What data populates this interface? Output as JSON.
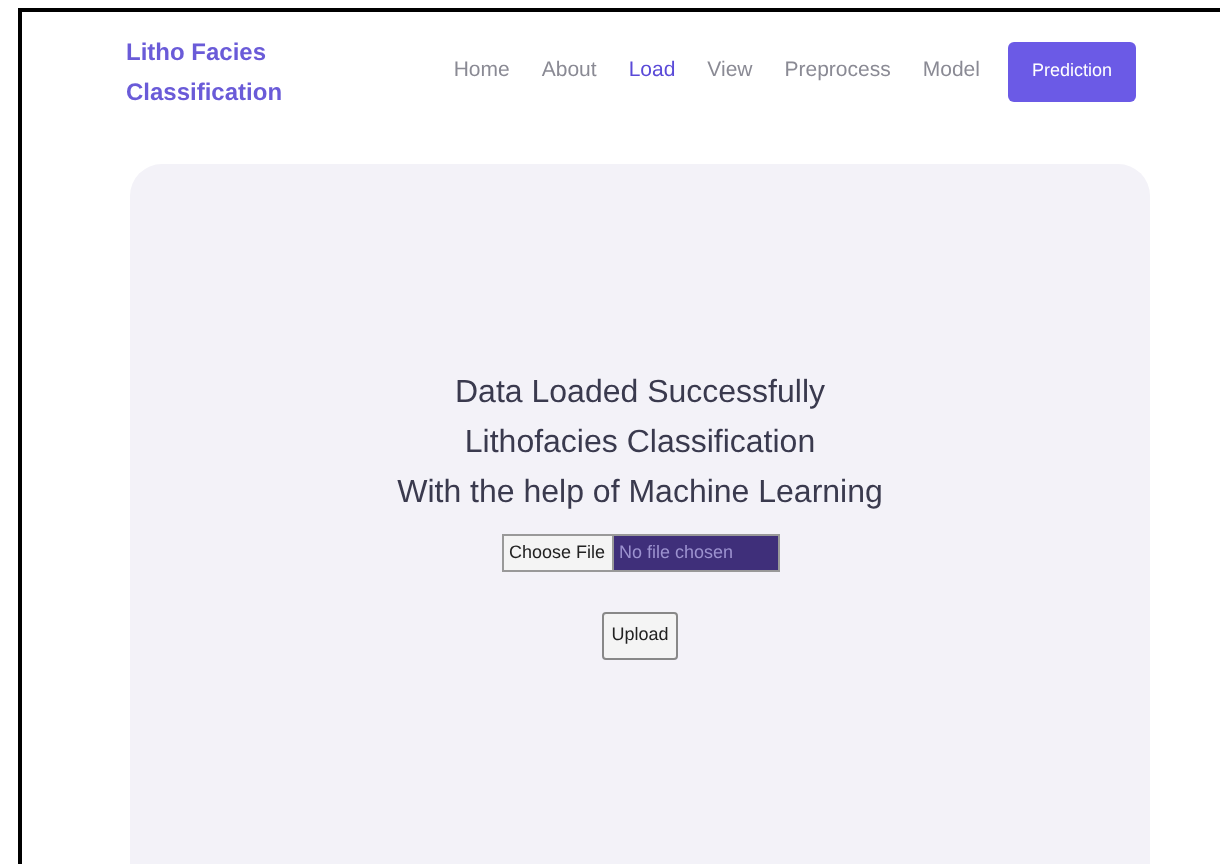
{
  "brand": {
    "line1": "Litho Facies",
    "line2": "Classification"
  },
  "nav": [
    {
      "label": "Home",
      "selected": false,
      "kind": "link"
    },
    {
      "label": "About",
      "selected": false,
      "kind": "link"
    },
    {
      "label": "Load",
      "selected": true,
      "kind": "link"
    },
    {
      "label": "View",
      "selected": false,
      "kind": "link"
    },
    {
      "label": "Preprocess",
      "selected": false,
      "kind": "link"
    },
    {
      "label": "Model",
      "selected": false,
      "kind": "link"
    },
    {
      "label": "Prediction",
      "selected": false,
      "kind": "button"
    }
  ],
  "main": {
    "headings": [
      "Data Loaded Successfully",
      "Lithofacies Classification",
      "With the help of Machine Learning"
    ],
    "file_input": {
      "button": "Choose File",
      "status": "No file chosen"
    },
    "upload_button": "Upload"
  }
}
